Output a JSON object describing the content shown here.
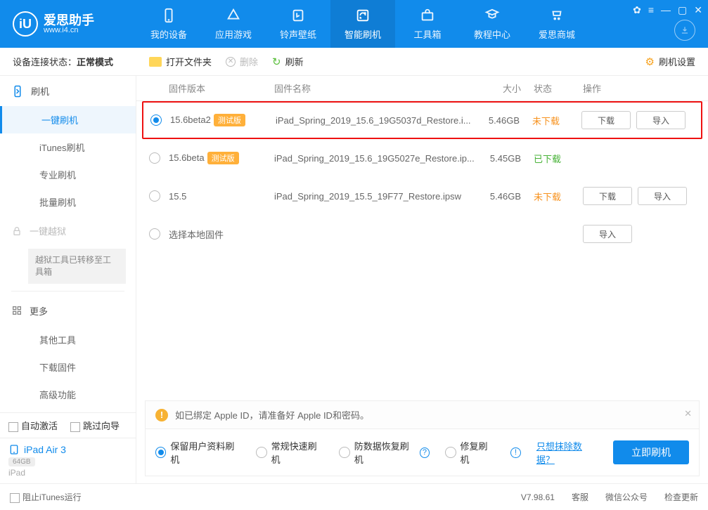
{
  "brand": {
    "name": "爱思助手",
    "site": "www.i4.cn",
    "logo_initials": "iU"
  },
  "topnav": [
    {
      "label": "我的设备"
    },
    {
      "label": "应用游戏"
    },
    {
      "label": "铃声壁纸"
    },
    {
      "label": "智能刷机"
    },
    {
      "label": "工具箱"
    },
    {
      "label": "教程中心"
    },
    {
      "label": "爱思商城"
    }
  ],
  "status": {
    "label": "设备连接状态：",
    "value": "正常模式"
  },
  "toolbar": {
    "open": "打开文件夹",
    "delete": "删除",
    "refresh": "刷新",
    "settings": "刷机设置"
  },
  "sidebar": {
    "flash_group": "刷机",
    "items": [
      "一键刷机",
      "iTunes刷机",
      "专业刷机",
      "批量刷机"
    ],
    "jailbreak_group": "一键越狱",
    "jailbreak_note": "越狱工具已转移至工具箱",
    "more_group": "更多",
    "more_items": [
      "其他工具",
      "下载固件",
      "高级功能"
    ]
  },
  "bottom_controls": {
    "auto_activate": "自动激活",
    "skip_guide": "跳过向导"
  },
  "device": {
    "name": "iPad Air 3",
    "storage": "64GB",
    "type": "iPad"
  },
  "columns": {
    "version": "固件版本",
    "name": "固件名称",
    "size": "大小",
    "status": "状态",
    "ops": "操作"
  },
  "rows": [
    {
      "version": "15.6beta2",
      "beta": "测试版",
      "name": "iPad_Spring_2019_15.6_19G5037d_Restore.i...",
      "size": "5.46GB",
      "status": "未下载",
      "status_color": "orange",
      "selected": true,
      "highlight": true,
      "download": "下载",
      "import": "导入"
    },
    {
      "version": "15.6beta",
      "beta": "测试版",
      "name": "iPad_Spring_2019_15.6_19G5027e_Restore.ip...",
      "size": "5.45GB",
      "status": "已下载",
      "status_color": "green",
      "selected": false
    },
    {
      "version": "15.5",
      "name": "iPad_Spring_2019_15.5_19F77_Restore.ipsw",
      "size": "5.46GB",
      "status": "未下载",
      "status_color": "orange",
      "selected": false,
      "download": "下载",
      "import": "导入"
    },
    {
      "version": "选择本地固件",
      "selected": false,
      "import": "导入"
    }
  ],
  "notice": "如已绑定 Apple ID，请准备好 Apple ID和密码。",
  "options": {
    "opt1": "保留用户资料刷机",
    "opt2": "常规快速刷机",
    "opt3": "防数据恢复刷机",
    "opt4": "修复刷机",
    "wipe_link": "只想抹除数据？",
    "primary": "立即刷机"
  },
  "footer": {
    "block_itunes": "阻止iTunes运行",
    "version": "V7.98.61",
    "support": "客服",
    "wechat": "微信公众号",
    "update": "检查更新"
  }
}
